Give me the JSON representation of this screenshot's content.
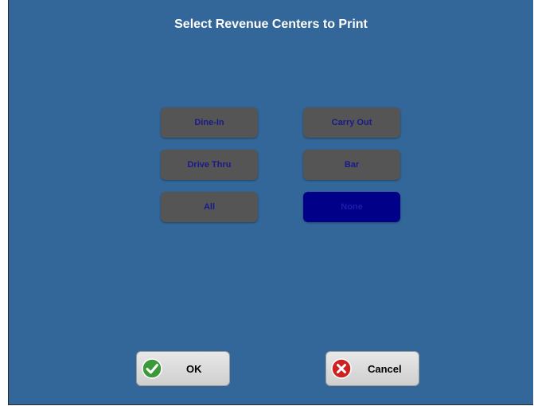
{
  "dialog": {
    "title": "Select Revenue Centers to Print"
  },
  "revenue_centers": [
    {
      "label": "Dine-In",
      "selected": false
    },
    {
      "label": "Carry Out",
      "selected": false
    },
    {
      "label": "Drive Thru",
      "selected": false
    },
    {
      "label": "Bar",
      "selected": false
    },
    {
      "label": "All",
      "selected": false
    },
    {
      "label": "None",
      "selected": true
    }
  ],
  "actions": {
    "ok_label": "OK",
    "ok_icon": "checkmark-icon",
    "cancel_label": "Cancel",
    "cancel_icon": "x-icon"
  },
  "colors": {
    "background": "#336699",
    "button_default": "#555555",
    "button_selected": "#000088",
    "button_text": "#1a1a8c",
    "ok_icon": "#3a9a3a",
    "cancel_icon": "#cc2222"
  }
}
